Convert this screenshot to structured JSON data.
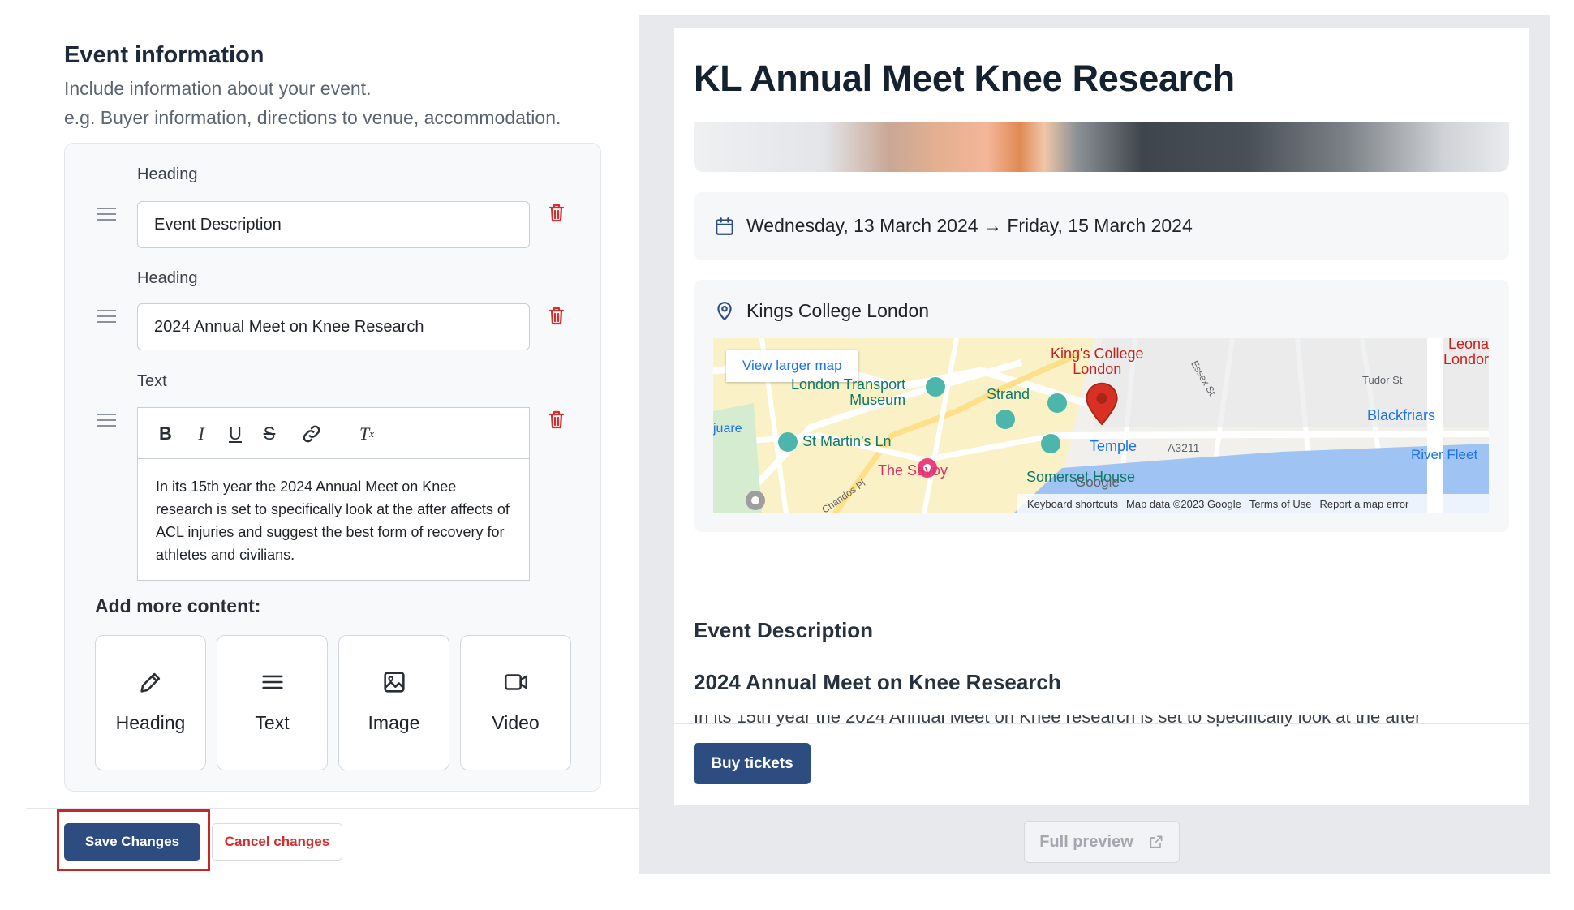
{
  "editor": {
    "title": "Event information",
    "subtitle_line1": "Include information about your event.",
    "subtitle_line2": "e.g. Buyer information, directions to venue, accommodation.",
    "blocks": [
      {
        "label": "Heading",
        "value": "Event Description"
      },
      {
        "label": "Heading",
        "value": "2024 Annual Meet on Knee Research"
      },
      {
        "label": "Text",
        "value": "In its 15th year the 2024 Annual Meet on Knee research is set to specifically look at the after affects of ACL injuries and suggest the best form of recovery for athletes and civilians."
      }
    ],
    "toolbar": {
      "bold": "B",
      "italic": "I",
      "underline": "U",
      "strike": "S",
      "link": "link-icon",
      "clear": "Tx"
    },
    "add_more_label": "Add more content:",
    "content_types": [
      "Heading",
      "Text",
      "Image",
      "Video"
    ],
    "save_label": "Save Changes",
    "cancel_label": "Cancel changes"
  },
  "preview": {
    "title": "KL Annual Meet Knee Research",
    "date_range": "Wednesday, 13 March 2024 → Friday, 15 March 2024",
    "location": "Kings College London",
    "map": {
      "view_larger": "View larger map",
      "labels": {
        "kings_college": "King's College\nLondon",
        "transport_museum": "London Transport\nMuseum",
        "strand": "Strand",
        "st_martins": "St Martin's Ln",
        "savoy": "The Savoy",
        "temple": "Temple",
        "a3211": "A3211",
        "somerset": "Somerset House",
        "blackfriars": "Blackfriars",
        "river_fleet": "River Fleet",
        "tudor": "Tudor St",
        "leonardo": "Leona\nLondor",
        "square": "juare",
        "chandos": "Chandos Pl",
        "essex": "Essex St",
        "google": "Google"
      },
      "footer": [
        "Keyboard shortcuts",
        "Map data ©2023 Google",
        "Terms of Use",
        "Report a map error"
      ]
    },
    "section_heading": "Event Description",
    "section_subheading": "2024 Annual Meet on Knee Research",
    "section_text_cut": "In its 15th year the 2024 Annual Meet on Knee research is set to specifically look at the after",
    "buy_label": "Buy tickets",
    "full_preview_label": "Full preview"
  },
  "colors": {
    "primary": "#2d4c80",
    "danger": "#d32f2f",
    "map_pin": "#d93025",
    "map_water": "#9fc3f2"
  }
}
